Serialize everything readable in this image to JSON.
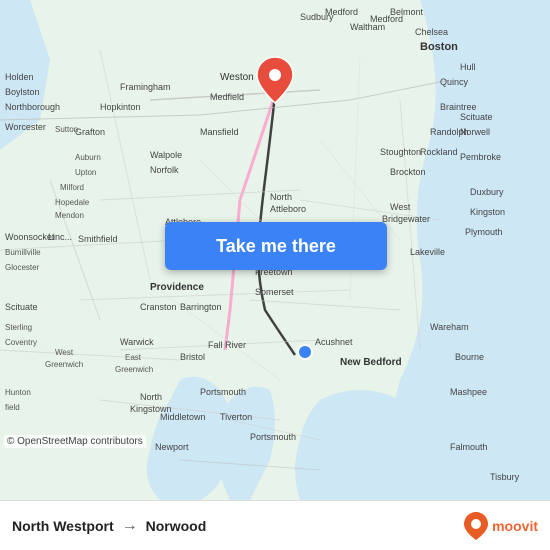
{
  "map": {
    "background_color": "#e8f4e8",
    "attribution": "© OpenStreetMap contributors"
  },
  "button": {
    "label": "Take me there"
  },
  "bottom_bar": {
    "origin": "North Westport",
    "destination": "Norwood",
    "arrow": "→"
  },
  "moovit": {
    "text": "moovit",
    "logo_color": "#e63"
  },
  "pin": {
    "destination_color": "#e74c3c",
    "origin_color": "#3b82f6"
  }
}
